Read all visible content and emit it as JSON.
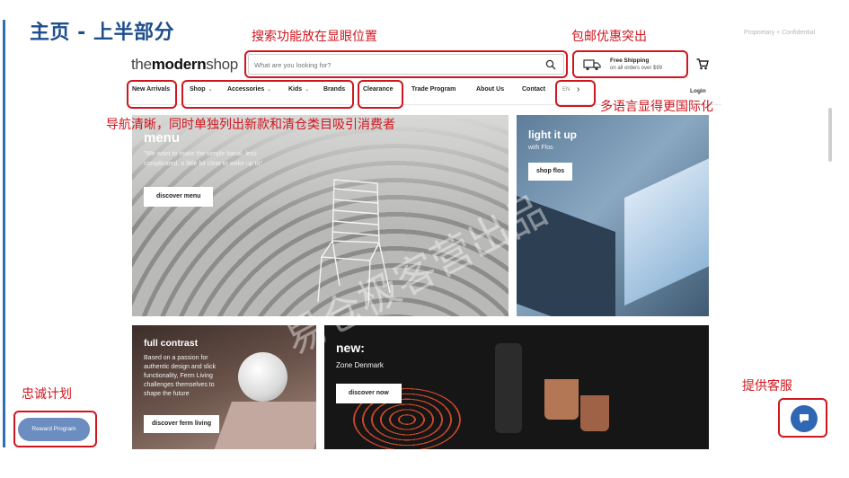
{
  "slide": {
    "title": "主页 - 上半部分",
    "confidential": "Proprietary + Confidential"
  },
  "site": {
    "logo_light": "the",
    "logo_bold": "modern",
    "logo_end": "shop",
    "search_placeholder": "What are you looking for?",
    "shipping_title": "Free Shipping",
    "shipping_sub": "on all orders over $99",
    "nav": [
      {
        "label": "New Arrivals",
        "chevron": false
      },
      {
        "label": "Shop",
        "chevron": true
      },
      {
        "label": "Accessories",
        "chevron": true
      },
      {
        "label": "Kids",
        "chevron": true
      },
      {
        "label": "Brands",
        "chevron": false
      },
      {
        "label": "Clearance",
        "chevron": false
      },
      {
        "label": "Trade Program",
        "chevron": false
      },
      {
        "label": "About Us",
        "chevron": false
      },
      {
        "label": "Contact",
        "chevron": false
      }
    ],
    "lang_code": "EN",
    "login": "Login"
  },
  "tiles": {
    "menu": {
      "title": "menu",
      "sub1": "\"We want to make the simple banal, less",
      "sub2": "complicated, a little bit clear to wake up to\"",
      "button": "discover menu"
    },
    "light": {
      "title": "light it up",
      "sub": "with Flos",
      "button": "shop flos"
    },
    "contrast": {
      "title": "full contrast",
      "lines": [
        "Based on a passion for",
        "authentic design and slick",
        "functionality, Ferm Living",
        "challenges themselves to",
        "shape the future"
      ],
      "button": "discover ferm living"
    },
    "new": {
      "title": "new:",
      "sub": "Zone Denmark",
      "button": "discover now"
    }
  },
  "widgets": {
    "reward": "Reward Program"
  },
  "annotations": {
    "search": "搜索功能放在显眼位置",
    "shipping": "包邮优惠突出",
    "nav": "导航清晰，同时单独列出新款和清仓类目吸引消费者",
    "lang": "多语言显得更国际化",
    "loyalty": "忠诚计划",
    "support": "提供客服"
  },
  "watermark": "易仓极客营出品",
  "colors": {
    "annotation": "#d0161e",
    "title": "#1f4e8c",
    "chat": "#2f67b3",
    "reward": "#6b8dbf"
  }
}
